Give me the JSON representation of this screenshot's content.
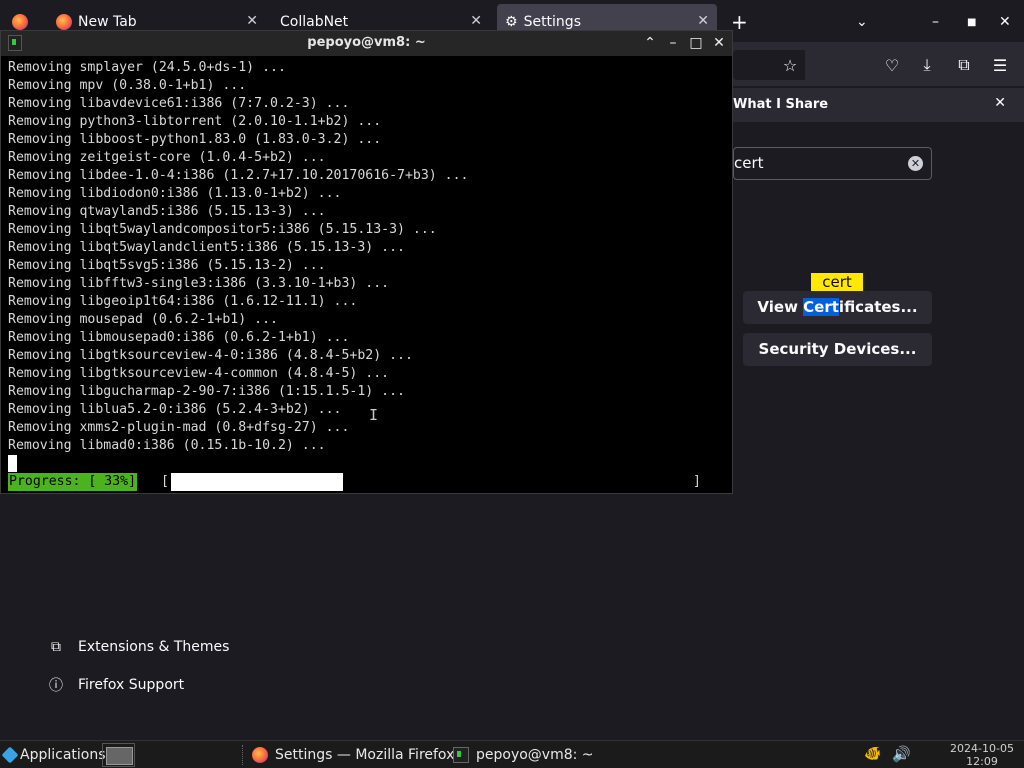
{
  "firefox": {
    "tabs": [
      {
        "label": "New Tab"
      },
      {
        "label": "CollabNet"
      },
      {
        "label": "Settings"
      }
    ],
    "new_tab_glyph": "+",
    "tab_close_glyph": "✕",
    "notice_text": "What I Share",
    "search_value": "cert",
    "tooltip": "cert",
    "buttons": {
      "view_certificates": {
        "pre": "View ",
        "highlight": "Cert",
        "post": "ificates..."
      },
      "security_devices": "Security Devices..."
    },
    "sidebar": {
      "extensions": "Extensions & Themes",
      "support": "Firefox Support"
    }
  },
  "terminal": {
    "title": "pepoyo@vm8: ~",
    "lines": [
      "Removing smplayer (24.5.0+ds-1) ...",
      "Removing mpv (0.38.0-1+b1) ...",
      "Removing libavdevice61:i386 (7:7.0.2-3) ...",
      "Removing python3-libtorrent (2.0.10-1.1+b2) ...",
      "Removing libboost-python1.83.0 (1.83.0-3.2) ...",
      "Removing zeitgeist-core (1.0.4-5+b2) ...",
      "Removing libdee-1.0-4:i386 (1.2.7+17.10.20170616-7+b3) ...",
      "Removing libdiodon0:i386 (1.13.0-1+b2) ...",
      "Removing qtwayland5:i386 (5.15.13-3) ...",
      "Removing libqt5waylandcompositor5:i386 (5.15.13-3) ...",
      "Removing libqt5waylandclient5:i386 (5.15.13-3) ...",
      "Removing libqt5svg5:i386 (5.15.13-2) ...",
      "Removing libfftw3-single3:i386 (3.3.10-1+b3) ...",
      "Removing libgeoip1t64:i386 (1.6.12-11.1) ...",
      "Removing mousepad (0.6.2-1+b1) ...",
      "Removing libmousepad0:i386 (0.6.2-1+b1) ...",
      "Removing libgtksourceview-4-0:i386 (4.8.4-5+b2) ...",
      "Removing libgtksourceview-4-common (4.8.4-5) ...",
      "Removing libgucharmap-2-90-7:i386 (1:15.1.5-1) ...",
      "Removing liblua5.2-0:i386 (5.2.4-3+b2) ...",
      "Removing xmms2-plugin-mad (0.8+dfsg-27) ...",
      "Removing libmad0:i386 (0.15.1b-10.2) ..."
    ],
    "progress_label": "Progress: [ 33%]",
    "progress_fraction": 0.33,
    "bracket_open": "[",
    "bracket_close": "]"
  },
  "taskbar": {
    "applications": "Applications",
    "tasks": [
      {
        "label": "Settings — Mozilla Firefox"
      },
      {
        "label": "pepoyo@vm8: ~"
      }
    ],
    "clock": {
      "date": "2024-10-05",
      "time": "12:09"
    }
  }
}
